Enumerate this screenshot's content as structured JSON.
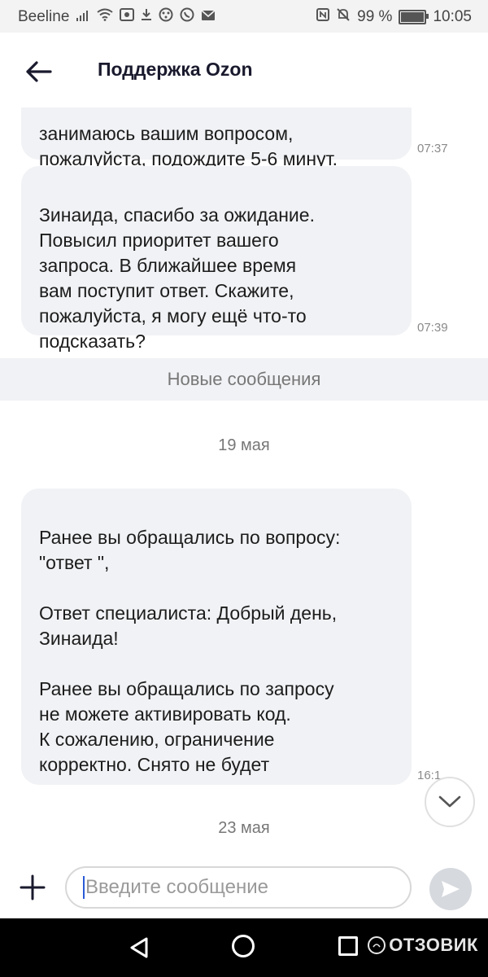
{
  "status_bar": {
    "carrier": "Beeline",
    "battery": "99 %",
    "battery_level": 0.99,
    "time": "10:05"
  },
  "header": {
    "title": "Поддержка Ozon"
  },
  "messages": [
    {
      "text": "занимаюсь вашим вопросом,\nпожалуйста, подождите 5-6 минут.",
      "time": "07:37"
    },
    {
      "text": "Зинаида, спасибо за ожидание.\nПовысил приоритет вашего\nзапроса. В ближайшее время\nвам поступит ответ. Скажите,\nпожалуйста, я могу ещё что-то\nподсказать?",
      "time": "07:39"
    },
    {
      "text": "Ранее вы обращались по вопросу:\n\"ответ \",\n\nОтвет специалиста: Добрый день,\nЗинаида!\n\nРанее вы обращались по запросу\nне можете активировать код.\nК сожалению, ограничение\nкорректно. Снято не будет",
      "time": "16:1"
    }
  ],
  "new_messages_label": "Новые сообщения",
  "dates": [
    "19 мая",
    "23 мая"
  ],
  "input": {
    "placeholder": "Введите сообщение"
  },
  "watermark": "ОТЗОВИК"
}
